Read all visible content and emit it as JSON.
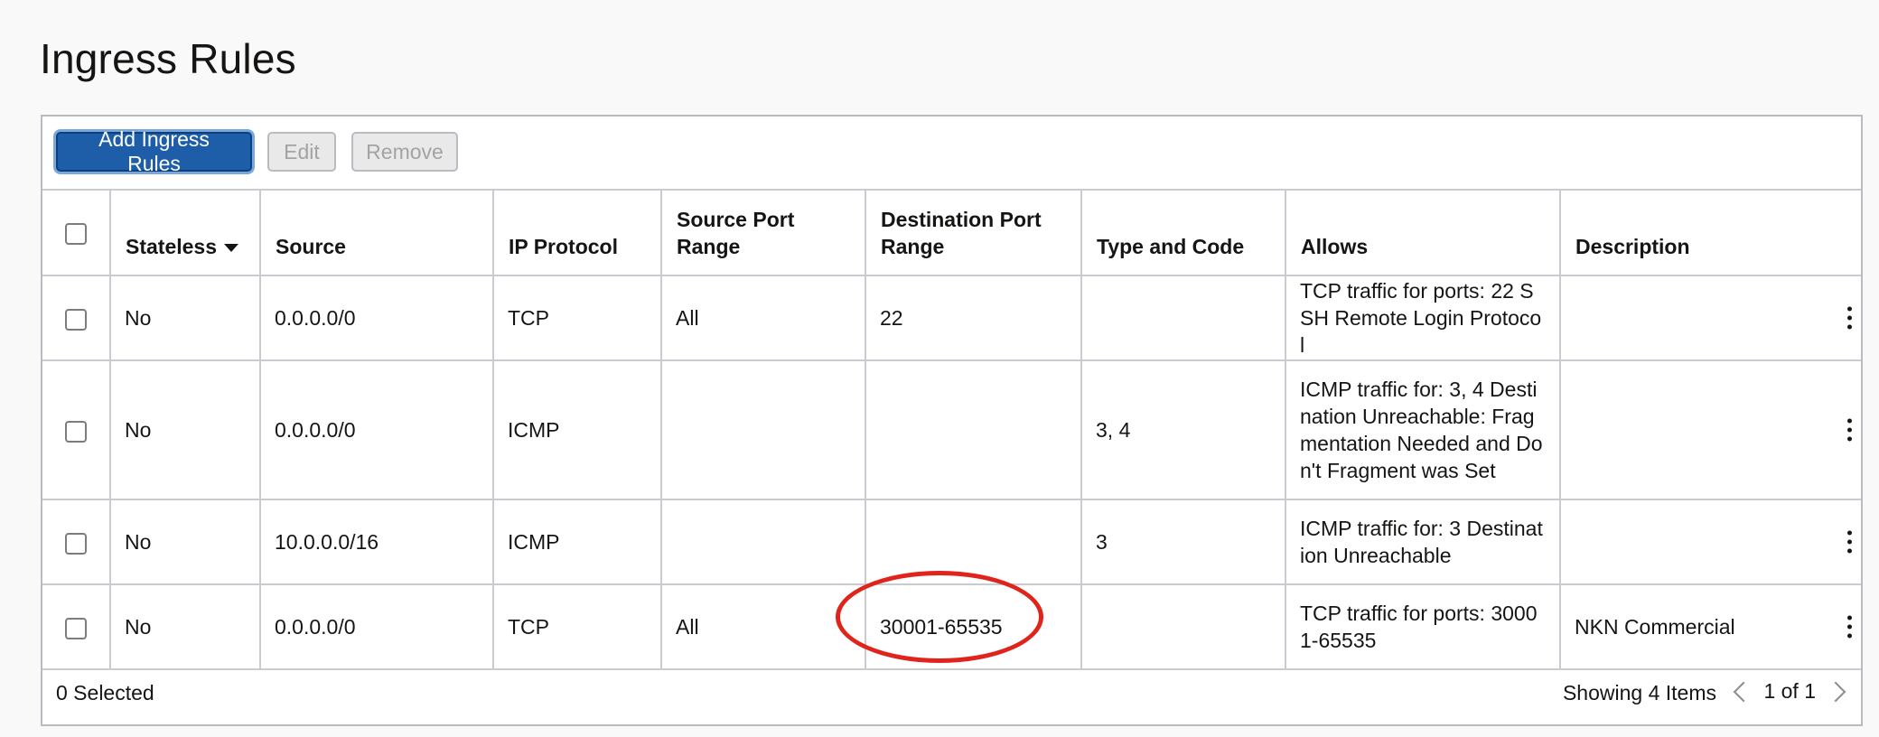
{
  "page": {
    "title": "Ingress Rules"
  },
  "toolbar": {
    "add_label": "Add Ingress Rules",
    "edit_label": "Edit",
    "remove_label": "Remove"
  },
  "table": {
    "headers": {
      "stateless": "Stateless",
      "source": "Source",
      "ip_protocol": "IP Protocol",
      "source_port_range": "Source Port Range",
      "destination_port_range": "Destination Port Range",
      "type_and_code": "Type and Code",
      "allows": "Allows",
      "description": "Description"
    },
    "rows": [
      {
        "stateless": "No",
        "source": "0.0.0.0/0",
        "ip_protocol": "TCP",
        "source_port_range": "All",
        "destination_port_range": "22",
        "type_and_code": "",
        "allows": "TCP traffic for ports: 22 SSH Remote Login Protocol",
        "description": ""
      },
      {
        "stateless": "No",
        "source": "0.0.0.0/0",
        "ip_protocol": "ICMP",
        "source_port_range": "",
        "destination_port_range": "",
        "type_and_code": "3, 4",
        "allows": "ICMP traffic for: 3, 4 Destination Unreachable: Fragmentation Needed and Don't Fragment was Set",
        "description": ""
      },
      {
        "stateless": "No",
        "source": "10.0.0.0/16",
        "ip_protocol": "ICMP",
        "source_port_range": "",
        "destination_port_range": "",
        "type_and_code": "3",
        "allows": "ICMP traffic for: 3 Destination Unreachable",
        "description": ""
      },
      {
        "stateless": "No",
        "source": "0.0.0.0/0",
        "ip_protocol": "TCP",
        "source_port_range": "All",
        "destination_port_range": "30001-65535",
        "type_and_code": "",
        "allows": "TCP traffic for ports: 30001-65535",
        "description": "NKN Commercial"
      }
    ]
  },
  "footer": {
    "selected": "0 Selected",
    "showing": "Showing 4 Items",
    "page": "1 of 1"
  },
  "colors": {
    "primary": "#1e5ea8",
    "annotation": "#e0231b"
  }
}
